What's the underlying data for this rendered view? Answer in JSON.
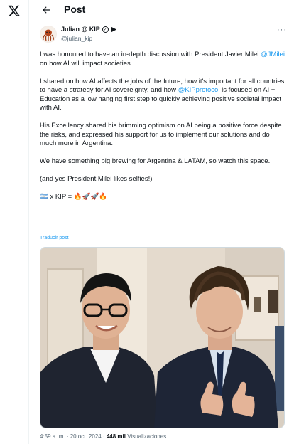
{
  "header": {
    "title": "Post"
  },
  "author": {
    "name": "Julian @ KIP",
    "handle": "@julian_kip"
  },
  "tweet": {
    "p1_a": "I was honoured to have an in-depth discussion with President Javier Milei ",
    "mention_milei": "@JMilei",
    "p1_b": " on how AI will impact societies.",
    "p2_a": "I shared on how AI affects the jobs of the future, how it's important for all countries to have a strategy for AI sovereignty, and how ",
    "mention_kip": "@KIPprotocol",
    "p2_b": " is focused on AI + Education as a low hanging first step to quickly achieving positive societal impact with AI.",
    "p3": "His Excellency shared his brimming optimism on AI being a positive force despite the risks, and expressed his support for us to implement our solutions and do much more in Argentina.",
    "p4": "We have something big brewing for Argentina & LATAM, so watch this space.",
    "p5": "(and yes President Milei likes selfies!)",
    "p6": "🇦🇷 x KIP = 🔥🚀🚀🔥"
  },
  "translate_label": "Traducir post",
  "meta": {
    "time": "4:59 a. m.",
    "sep": " · ",
    "date": "20 oct. 2024",
    "views": "448 mil",
    "views_label": "Visualizaciones"
  },
  "colors": {
    "accent": "#1d9bf0",
    "text": "#0f1419",
    "muted": "#536471"
  },
  "icons": [
    "x-logo-icon",
    "back-arrow-icon",
    "more-icon",
    "verified-badge-icon",
    "grok-badge-icon"
  ]
}
